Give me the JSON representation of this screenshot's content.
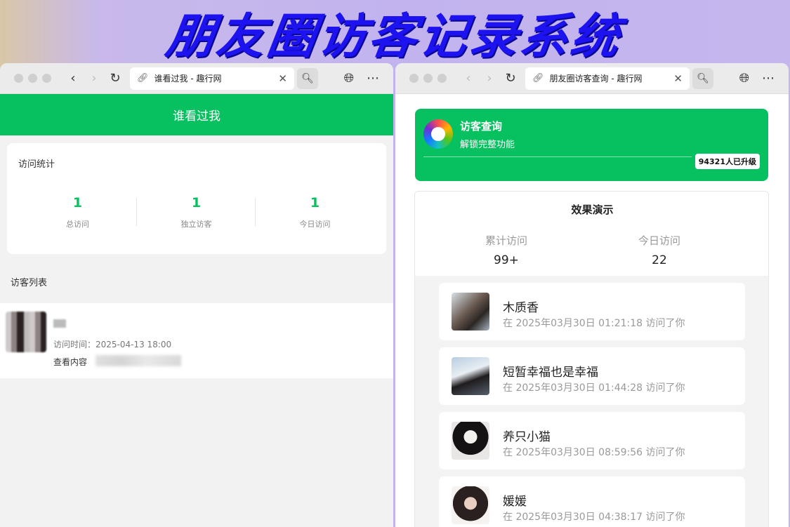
{
  "banner": {
    "title": "朋友圈访客记录系统"
  },
  "left_window": {
    "tab_title": "谁看过我 - 趣行网",
    "header_title": "谁看过我",
    "stats": {
      "title": "访问统计",
      "items": [
        {
          "value": "1",
          "label": "总访问"
        },
        {
          "value": "1",
          "label": "独立访客"
        },
        {
          "value": "1",
          "label": "今日访问"
        }
      ]
    },
    "visitor_list": {
      "title": "访客列表",
      "items": [
        {
          "time_text": "访问时间：2025-04-13 18:00",
          "content_label": "查看内容"
        }
      ]
    }
  },
  "right_window": {
    "tab_title": "朋友圈访客查询 - 趣行网",
    "promo": {
      "title": "访客查询",
      "subtitle": "解锁完整功能",
      "badge": "94321人已升级"
    },
    "demo": {
      "title": "效果演示",
      "stats": [
        {
          "label": "累计访问",
          "value": "99+"
        },
        {
          "label": "今日访问",
          "value": "22"
        }
      ],
      "visitors": [
        {
          "name": "木质香",
          "time": "在 2025年03月30日 01:21:18 访问了你"
        },
        {
          "name": "短暂幸福也是幸福",
          "time": "在 2025年03月30日 01:44:28 访问了你"
        },
        {
          "name": "养只小猫",
          "time": "在 2025年03月30日 08:59:56 访问了你"
        },
        {
          "name": "媛媛",
          "time": "在 2025年03月30日 04:38:17 访问了你"
        }
      ]
    }
  },
  "colors": {
    "primary_green": "#07c160",
    "banner_blue": "#1d12f0"
  }
}
